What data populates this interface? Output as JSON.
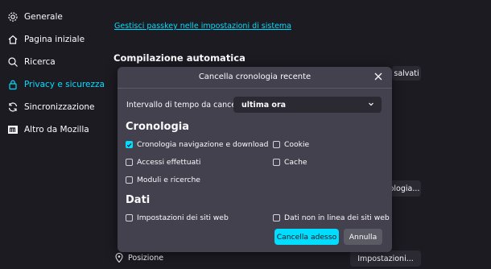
{
  "sidebar": {
    "items": [
      {
        "label": "Generale",
        "icon": "gear-icon"
      },
      {
        "label": "Pagina iniziale",
        "icon": "home-icon"
      },
      {
        "label": "Ricerca",
        "icon": "search-icon"
      },
      {
        "label": "Privacy e sicurezza",
        "icon": "lock-icon"
      },
      {
        "label": "Sincronizzazione",
        "icon": "sync-icon"
      },
      {
        "label": "Altro da Mozilla",
        "icon": "mozilla-icon"
      }
    ],
    "active_index": 3
  },
  "background": {
    "passkey_link": "Gestisci passkey nelle impostazioni di sistema",
    "autofill_heading": "Compilazione automatica",
    "saved_button": "salvati",
    "cronologia_button": "ologia...",
    "position_label": "Posizione",
    "settings_button": "Impostazioni..."
  },
  "dialog": {
    "title": "Cancella cronologia recente",
    "range_label": "Intervallo di tempo da cancellare:",
    "range_value": "ultima ora",
    "history_heading": "Cronologia",
    "history_options": [
      {
        "label": "Cronologia navigazione e download",
        "checked": true
      },
      {
        "label": "Cookie",
        "checked": false
      },
      {
        "label": "Accessi effettuati",
        "checked": false
      },
      {
        "label": "Cache",
        "checked": false
      },
      {
        "label": "Moduli e ricerche",
        "checked": false
      }
    ],
    "data_heading": "Dati",
    "data_options": [
      {
        "label": "Impostazioni dei siti web",
        "checked": false
      },
      {
        "label": "Dati non in linea dei siti web",
        "checked": false
      }
    ],
    "clear_button": "Cancella adesso",
    "cancel_button": "Annulla"
  },
  "colors": {
    "accent": "#00ddff",
    "background": "#1c1b22",
    "dialog": "#42414d"
  }
}
